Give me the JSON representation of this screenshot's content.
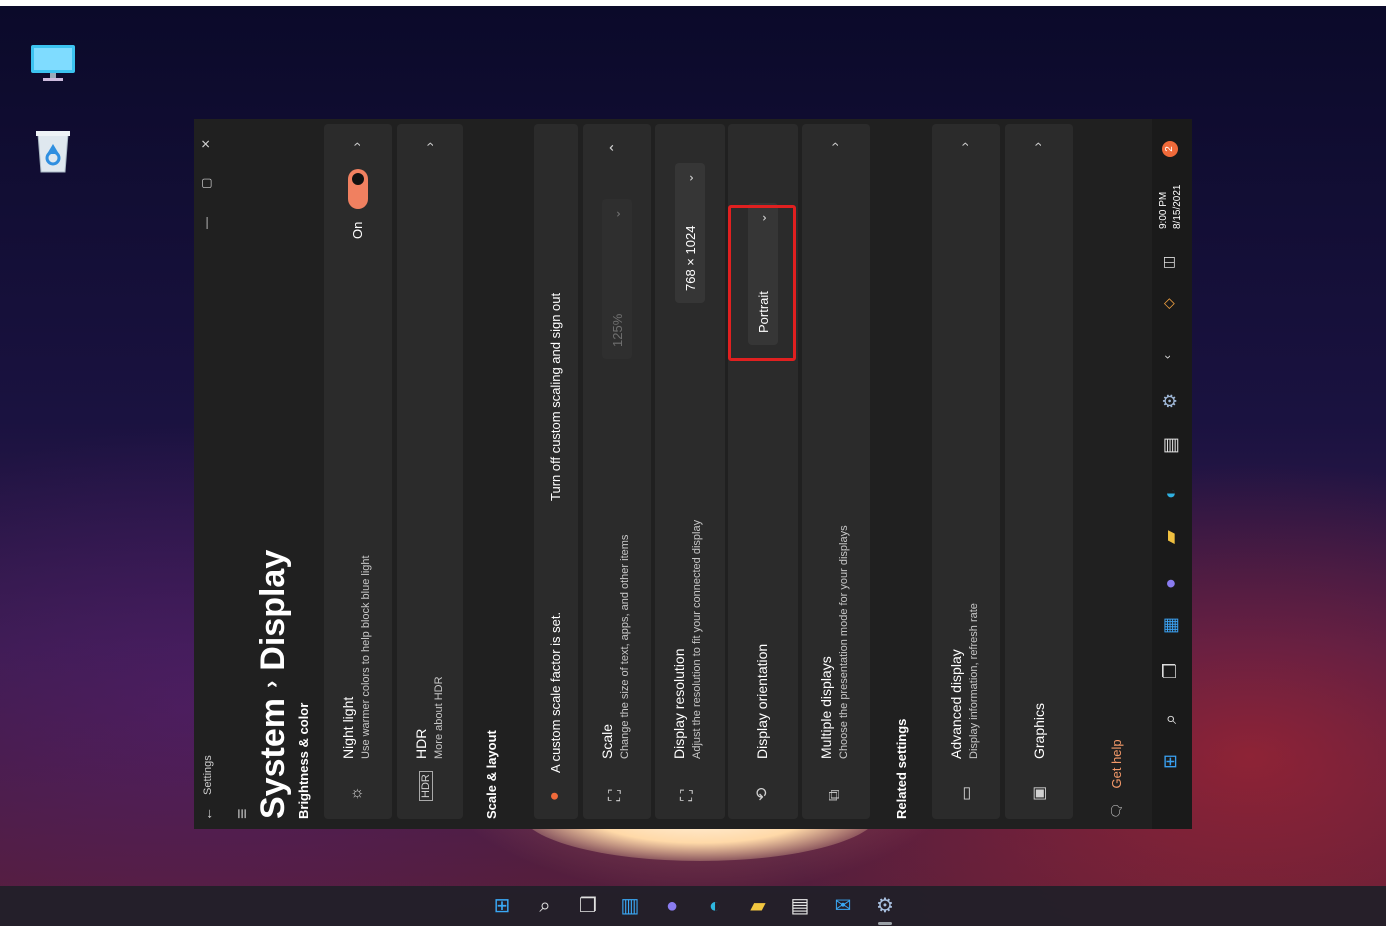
{
  "settings": {
    "app_title": "Settings",
    "breadcrumb_parent": "System",
    "breadcrumb_sep": "›",
    "page_title": "Display",
    "sections": {
      "brightness": "Brightness & color",
      "scale_layout": "Scale & layout",
      "related": "Related settings"
    },
    "night_light": {
      "title": "Night light",
      "desc": "Use warmer colors to help block blue light",
      "toggle_state": "On"
    },
    "hdr": {
      "title": "HDR",
      "link": "More about HDR"
    },
    "custom_scale": {
      "message": "A custom scale factor is set.",
      "link": "Turn off custom scaling and sign out"
    },
    "scale": {
      "title": "Scale",
      "desc": "Change the size of text, apps, and other items",
      "value": "125%"
    },
    "resolution": {
      "title": "Display resolution",
      "desc": "Adjust the resolution to fit your connected display",
      "value": "768 × 1024"
    },
    "orientation": {
      "title": "Display orientation",
      "value": "Portrait"
    },
    "multiple": {
      "title": "Multiple displays",
      "desc": "Choose the presentation mode for your displays"
    },
    "advanced": {
      "title": "Advanced display",
      "desc": "Display information, refresh rate"
    },
    "graphics": {
      "title": "Graphics"
    },
    "get_help": "Get help",
    "clock_time": "9:00 PM",
    "clock_date": "8/15/2021",
    "notification_count": "2"
  },
  "colors": {
    "accent": "#f08060",
    "highlight": "#e02020",
    "link": "#f59a6a"
  },
  "icons": [
    "monitor-icon",
    "recycle-bin-icon",
    "start-icon",
    "search-icon",
    "task-view-icon",
    "widgets-icon",
    "chat-icon",
    "edge-icon",
    "file-explorer-icon",
    "store-icon",
    "mail-icon",
    "settings-icon"
  ]
}
